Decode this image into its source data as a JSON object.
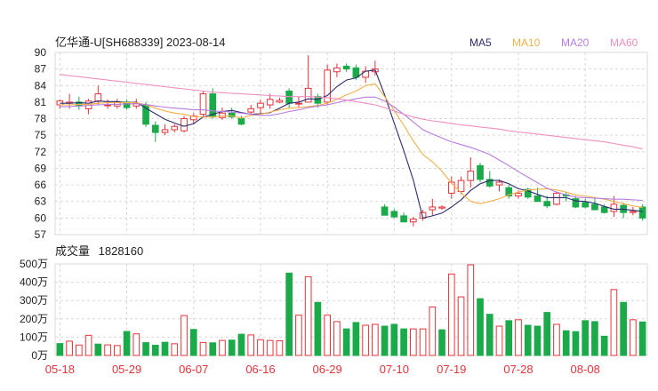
{
  "header": {
    "title": "亿华通-U[SH688339] 2023-08-14",
    "legend": [
      {
        "label": "MA5",
        "color": "#2b2b6f"
      },
      {
        "label": "MA10",
        "color": "#f5b04a"
      },
      {
        "label": "MA20",
        "color": "#b77ce0"
      },
      {
        "label": "MA60",
        "color": "#f08fc0"
      }
    ]
  },
  "volume_header": {
    "label": "成交量",
    "value": "1828160"
  },
  "colors": {
    "up": "#e8333a",
    "down": "#1aaa4a",
    "grid": "#d8d8d8",
    "axis_text": "#222222",
    "date_text": "#e8333a"
  },
  "chart_data": [
    {
      "type": "candlestick",
      "title": "亿华通-U[SH688339] 2023-08-14",
      "y_ticks": [
        90,
        87,
        84,
        81,
        78,
        75,
        72,
        69,
        66,
        63,
        60,
        57
      ],
      "ylim": [
        57,
        90
      ],
      "grid": true,
      "legend_position": "top-right",
      "series": [
        {
          "name": "OHLC",
          "ohlc": [
            [
              80.5,
              81.5,
              79.8,
              81.2
            ],
            [
              80.8,
              82.5,
              79.8,
              81.0
            ],
            [
              81.0,
              82.0,
              79.6,
              80.3
            ],
            [
              79.8,
              81.6,
              78.8,
              81.2
            ],
            [
              81.2,
              84.0,
              80.5,
              82.5
            ],
            [
              80.5,
              81.5,
              79.8,
              80.5
            ],
            [
              80.3,
              81.6,
              79.8,
              81.0
            ],
            [
              81.0,
              81.5,
              79.6,
              80.0
            ],
            [
              80.3,
              81.6,
              79.8,
              80.8
            ],
            [
              80.5,
              81.0,
              76.5,
              77.0
            ],
            [
              76.8,
              77.5,
              73.8,
              75.5
            ],
            [
              75.5,
              77.0,
              75.0,
              76.0
            ],
            [
              76.0,
              77.0,
              75.5,
              76.6
            ],
            [
              75.8,
              78.5,
              75.5,
              78.0
            ],
            [
              77.8,
              79.0,
              77.0,
              78.5
            ],
            [
              78.8,
              83.0,
              78.2,
              82.5
            ],
            [
              82.5,
              83.5,
              78.0,
              78.3
            ],
            [
              78.2,
              80.0,
              77.8,
              79.0
            ],
            [
              79.0,
              80.0,
              78.0,
              78.3
            ],
            [
              78.0,
              78.5,
              76.8,
              77.0
            ],
            [
              79.2,
              80.5,
              78.8,
              79.8
            ],
            [
              80.0,
              81.5,
              78.8,
              80.8
            ],
            [
              80.5,
              82.5,
              79.8,
              81.5
            ],
            [
              81.0,
              81.8,
              80.8,
              81.3
            ],
            [
              83.0,
              83.5,
              80.0,
              80.8
            ],
            [
              80.8,
              82.0,
              80.0,
              80.8
            ],
            [
              81.0,
              89.5,
              81.0,
              83.5
            ],
            [
              82.0,
              82.5,
              80.0,
              80.8
            ],
            [
              81.0,
              87.8,
              80.5,
              86.8
            ],
            [
              86.5,
              88.0,
              85.5,
              87.2
            ],
            [
              87.5,
              88.0,
              86.5,
              87.0
            ],
            [
              87.2,
              87.8,
              85.0,
              85.5
            ],
            [
              85.5,
              87.5,
              84.5,
              86.6
            ],
            [
              86.5,
              88.5,
              85.8,
              87.0
            ],
            [
              62.0,
              62.5,
              60.5,
              60.5
            ],
            [
              61.2,
              61.6,
              60.0,
              60.2
            ],
            [
              60.4,
              61.0,
              59.2,
              59.3
            ],
            [
              59.3,
              60.2,
              58.5,
              59.8
            ],
            [
              60.0,
              61.5,
              59.5,
              61.0
            ],
            [
              61.5,
              63.5,
              60.5,
              62.0
            ],
            [
              61.8,
              62.3,
              61.5,
              62.0
            ],
            [
              64.5,
              67.5,
              63.5,
              66.5
            ],
            [
              64.8,
              67.5,
              64.3,
              66.8
            ],
            [
              66.8,
              71.0,
              65.5,
              68.5
            ],
            [
              69.5,
              70.0,
              66.5,
              67.0
            ],
            [
              67.0,
              68.5,
              65.5,
              65.8
            ],
            [
              66.0,
              67.0,
              64.8,
              66.5
            ],
            [
              65.5,
              66.0,
              63.5,
              64.0
            ],
            [
              64.0,
              65.0,
              63.5,
              64.5
            ],
            [
              65.2,
              65.5,
              63.5,
              63.8
            ],
            [
              64.0,
              65.5,
              63.5,
              63.0
            ],
            [
              63.0,
              64.0,
              61.8,
              62.2
            ],
            [
              62.5,
              64.8,
              62.3,
              64.5
            ],
            [
              64.2,
              64.8,
              63.0,
              64.0
            ],
            [
              63.5,
              64.0,
              61.8,
              62.0
            ],
            [
              62.8,
              63.5,
              61.8,
              62.0
            ],
            [
              62.5,
              63.8,
              61.5,
              61.5
            ],
            [
              62.0,
              62.5,
              60.8,
              61.0
            ],
            [
              61.2,
              64.0,
              60.2,
              62.5
            ],
            [
              62.3,
              62.8,
              60.0,
              61.0
            ],
            [
              61.0,
              62.0,
              60.5,
              61.2
            ],
            [
              62.0,
              62.5,
              59.5,
              60.0
            ]
          ]
        },
        {
          "name": "MA5",
          "values": [
            80.8,
            80.8,
            80.9,
            80.8,
            81.2,
            81.1,
            81.1,
            80.9,
            81.0,
            79.9,
            78.9,
            77.9,
            77.2,
            76.6,
            77.1,
            78.3,
            78.8,
            79.3,
            79.5,
            79.1,
            78.8,
            78.9,
            79.1,
            79.9,
            80.8,
            81.0,
            81.6,
            81.5,
            82.2,
            83.8,
            85.0,
            85.4,
            86.6,
            86.8,
            82.3,
            77.2,
            72.2,
            66.9,
            60.0,
            60.4,
            60.9,
            62.0,
            63.3,
            65.0,
            66.2,
            66.8,
            66.8,
            66.2,
            65.3,
            64.9,
            64.3,
            63.7,
            63.7,
            63.7,
            63.1,
            63.0,
            62.7,
            62.1,
            61.6,
            61.6,
            61.4,
            61.2
          ]
        },
        {
          "name": "MA10",
          "values": [
            80.5,
            80.5,
            80.6,
            80.6,
            80.8,
            80.9,
            80.9,
            80.9,
            80.9,
            80.5,
            79.9,
            79.4,
            79.0,
            78.8,
            78.4,
            78.3,
            78.3,
            78.5,
            78.5,
            78.1,
            78.6,
            78.8,
            79.2,
            79.6,
            79.9,
            80.0,
            80.2,
            80.4,
            80.8,
            81.5,
            82.3,
            83.0,
            84.0,
            84.3,
            82.0,
            79.5,
            76.8,
            74.0,
            71.5,
            70.2,
            68.5,
            66.3,
            64.6,
            63.0,
            62.6,
            63.0,
            63.5,
            64.2,
            64.7,
            65.1,
            65.2,
            65.3,
            65.1,
            64.7,
            64.2,
            64.0,
            63.7,
            63.4,
            63.0,
            62.6,
            62.2,
            61.9
          ]
        },
        {
          "name": "MA20",
          "values": [
            80.2,
            80.2,
            80.3,
            80.4,
            80.5,
            80.6,
            80.6,
            80.7,
            80.7,
            80.6,
            80.3,
            80.1,
            79.9,
            79.8,
            79.6,
            79.6,
            79.4,
            79.3,
            79.2,
            79.0,
            78.8,
            78.6,
            78.6,
            78.9,
            79.3,
            79.6,
            80.0,
            80.3,
            80.5,
            80.9,
            81.3,
            81.6,
            81.9,
            81.9,
            81.2,
            80.1,
            78.8,
            77.4,
            76.0,
            75.2,
            74.5,
            73.8,
            73.3,
            72.8,
            72.2,
            71.5,
            70.5,
            69.5,
            68.4,
            67.4,
            66.4,
            65.4,
            64.7,
            64.2,
            63.8,
            63.7,
            63.6,
            63.5,
            63.4,
            63.4,
            63.3,
            63.2
          ]
        },
        {
          "name": "MA60",
          "values": [
            86.0,
            85.8,
            85.6,
            85.4,
            85.2,
            85.0,
            84.8,
            84.6,
            84.4,
            84.2,
            84.0,
            83.8,
            83.6,
            83.4,
            83.2,
            83.0,
            82.8,
            82.7,
            82.6,
            82.5,
            82.4,
            82.3,
            82.2,
            82.1,
            82.0,
            82.0,
            82.0,
            81.9,
            81.8,
            81.6,
            81.4,
            81.1,
            80.8,
            80.5,
            80.0,
            79.4,
            78.8,
            78.3,
            77.9,
            77.6,
            77.4,
            77.1,
            76.9,
            76.7,
            76.5,
            76.3,
            76.1,
            75.8,
            75.6,
            75.4,
            75.2,
            75.0,
            74.8,
            74.6,
            74.4,
            74.2,
            74.0,
            73.8,
            73.5,
            73.2,
            72.9,
            72.5
          ]
        }
      ],
      "x_labels": [
        "05-18",
        "05-29",
        "06-07",
        "06-16",
        "06-29",
        "07-10",
        "07-19",
        "07-28",
        "08-08"
      ],
      "x_label_index": [
        0,
        7,
        14,
        21,
        28,
        35,
        41,
        48,
        55
      ]
    },
    {
      "type": "bar",
      "title": "成交量 1828160",
      "y_ticks": [
        "500万",
        "400万",
        "300万",
        "200万",
        "100万",
        "0万"
      ],
      "ylim": [
        0,
        5000000
      ],
      "grid": true,
      "values": [
        650000,
        780000,
        570000,
        1100000,
        620000,
        580000,
        540000,
        1310000,
        1180000,
        700000,
        560000,
        720000,
        640000,
        2180000,
        1420000,
        710000,
        690000,
        820000,
        840000,
        1160000,
        1120000,
        860000,
        820000,
        800000,
        4500000,
        2200000,
        4300000,
        2900000,
        2200000,
        1850000,
        1450000,
        1800000,
        1650000,
        1700000,
        1600000,
        1700000,
        1450000,
        1450000,
        1450000,
        2650000,
        1400000,
        4450000,
        3200000,
        4950000,
        3100000,
        2250000,
        1600000,
        1900000,
        1950000,
        1650000,
        1600000,
        2350000,
        1700000,
        1350000,
        1300000,
        1900000,
        1850000,
        1050000,
        3600000,
        2900000,
        1950000,
        1828160
      ],
      "up_down": [
        "d",
        "u",
        "u",
        "u",
        "d",
        "u",
        "u",
        "d",
        "u",
        "d",
        "d",
        "d",
        "u",
        "u",
        "d",
        "u",
        "d",
        "u",
        "d",
        "d",
        "u",
        "u",
        "u",
        "u",
        "d",
        "u",
        "u",
        "d",
        "u",
        "u",
        "d",
        "d",
        "u",
        "u",
        "d",
        "d",
        "d",
        "u",
        "u",
        "u",
        "d",
        "u",
        "u",
        "u",
        "d",
        "d",
        "u",
        "d",
        "u",
        "d",
        "d",
        "d",
        "u",
        "d",
        "d",
        "d",
        "d",
        "d",
        "u",
        "d",
        "u",
        "d"
      ]
    }
  ]
}
